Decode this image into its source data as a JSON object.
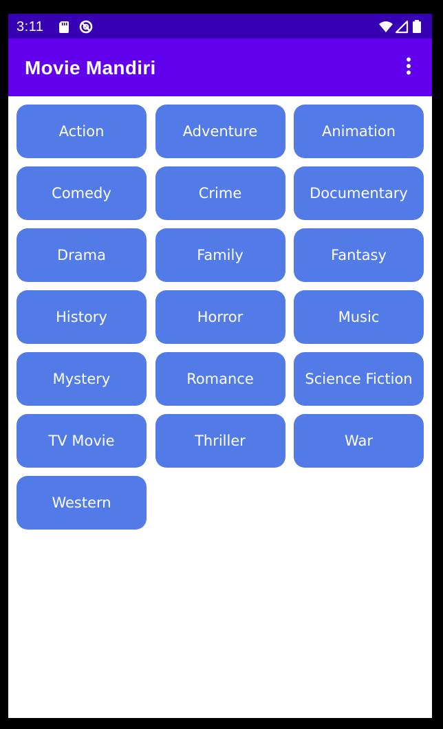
{
  "status_bar": {
    "time": "3:11",
    "icons": [
      "sd-card-icon",
      "no-disturb-icon",
      "wifi-icon",
      "signal-icon",
      "battery-icon"
    ],
    "color": "#3700b3"
  },
  "app_bar": {
    "title": "Movie Mandiri",
    "color": "#6200ee",
    "menu_icon": "more-vert-icon"
  },
  "genres": [
    {
      "label": "Action"
    },
    {
      "label": "Adventure"
    },
    {
      "label": "Animation"
    },
    {
      "label": "Comedy"
    },
    {
      "label": "Crime"
    },
    {
      "label": "Documentary"
    },
    {
      "label": "Drama"
    },
    {
      "label": "Family"
    },
    {
      "label": "Fantasy"
    },
    {
      "label": "History"
    },
    {
      "label": "Horror"
    },
    {
      "label": "Music"
    },
    {
      "label": "Mystery"
    },
    {
      "label": "Romance"
    },
    {
      "label": "Science Fiction"
    },
    {
      "label": "TV Movie"
    },
    {
      "label": "Thriller"
    },
    {
      "label": "War"
    },
    {
      "label": "Western"
    }
  ],
  "theme": {
    "button_color": "#527be8",
    "button_text_color": "#ffffff",
    "background": "#ffffff"
  }
}
